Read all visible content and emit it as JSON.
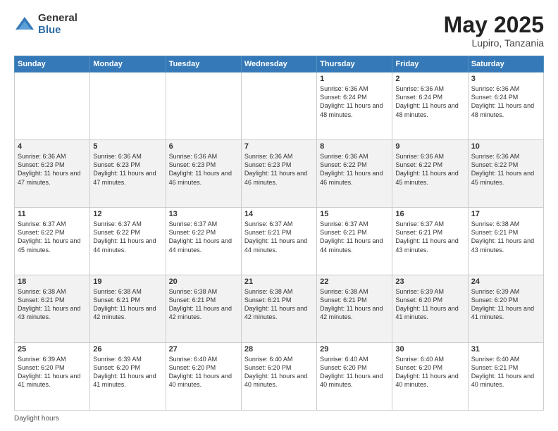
{
  "logo": {
    "general": "General",
    "blue": "Blue"
  },
  "title": {
    "month": "May 2025",
    "location": "Lupiro, Tanzania"
  },
  "days_of_week": [
    "Sunday",
    "Monday",
    "Tuesday",
    "Wednesday",
    "Thursday",
    "Friday",
    "Saturday"
  ],
  "footer": {
    "daylight_label": "Daylight hours"
  },
  "weeks": [
    [
      {
        "day": "",
        "info": ""
      },
      {
        "day": "",
        "info": ""
      },
      {
        "day": "",
        "info": ""
      },
      {
        "day": "",
        "info": ""
      },
      {
        "day": "1",
        "info": "Sunrise: 6:36 AM\nSunset: 6:24 PM\nDaylight: 11 hours\nand 48 minutes."
      },
      {
        "day": "2",
        "info": "Sunrise: 6:36 AM\nSunset: 6:24 PM\nDaylight: 11 hours\nand 48 minutes."
      },
      {
        "day": "3",
        "info": "Sunrise: 6:36 AM\nSunset: 6:24 PM\nDaylight: 11 hours\nand 48 minutes."
      }
    ],
    [
      {
        "day": "4",
        "info": "Sunrise: 6:36 AM\nSunset: 6:23 PM\nDaylight: 11 hours\nand 47 minutes."
      },
      {
        "day": "5",
        "info": "Sunrise: 6:36 AM\nSunset: 6:23 PM\nDaylight: 11 hours\nand 47 minutes."
      },
      {
        "day": "6",
        "info": "Sunrise: 6:36 AM\nSunset: 6:23 PM\nDaylight: 11 hours\nand 46 minutes."
      },
      {
        "day": "7",
        "info": "Sunrise: 6:36 AM\nSunset: 6:23 PM\nDaylight: 11 hours\nand 46 minutes."
      },
      {
        "day": "8",
        "info": "Sunrise: 6:36 AM\nSunset: 6:22 PM\nDaylight: 11 hours\nand 46 minutes."
      },
      {
        "day": "9",
        "info": "Sunrise: 6:36 AM\nSunset: 6:22 PM\nDaylight: 11 hours\nand 45 minutes."
      },
      {
        "day": "10",
        "info": "Sunrise: 6:36 AM\nSunset: 6:22 PM\nDaylight: 11 hours\nand 45 minutes."
      }
    ],
    [
      {
        "day": "11",
        "info": "Sunrise: 6:37 AM\nSunset: 6:22 PM\nDaylight: 11 hours\nand 45 minutes."
      },
      {
        "day": "12",
        "info": "Sunrise: 6:37 AM\nSunset: 6:22 PM\nDaylight: 11 hours\nand 44 minutes."
      },
      {
        "day": "13",
        "info": "Sunrise: 6:37 AM\nSunset: 6:22 PM\nDaylight: 11 hours\nand 44 minutes."
      },
      {
        "day": "14",
        "info": "Sunrise: 6:37 AM\nSunset: 6:21 PM\nDaylight: 11 hours\nand 44 minutes."
      },
      {
        "day": "15",
        "info": "Sunrise: 6:37 AM\nSunset: 6:21 PM\nDaylight: 11 hours\nand 44 minutes."
      },
      {
        "day": "16",
        "info": "Sunrise: 6:37 AM\nSunset: 6:21 PM\nDaylight: 11 hours\nand 43 minutes."
      },
      {
        "day": "17",
        "info": "Sunrise: 6:38 AM\nSunset: 6:21 PM\nDaylight: 11 hours\nand 43 minutes."
      }
    ],
    [
      {
        "day": "18",
        "info": "Sunrise: 6:38 AM\nSunset: 6:21 PM\nDaylight: 11 hours\nand 43 minutes."
      },
      {
        "day": "19",
        "info": "Sunrise: 6:38 AM\nSunset: 6:21 PM\nDaylight: 11 hours\nand 42 minutes."
      },
      {
        "day": "20",
        "info": "Sunrise: 6:38 AM\nSunset: 6:21 PM\nDaylight: 11 hours\nand 42 minutes."
      },
      {
        "day": "21",
        "info": "Sunrise: 6:38 AM\nSunset: 6:21 PM\nDaylight: 11 hours\nand 42 minutes."
      },
      {
        "day": "22",
        "info": "Sunrise: 6:38 AM\nSunset: 6:21 PM\nDaylight: 11 hours\nand 42 minutes."
      },
      {
        "day": "23",
        "info": "Sunrise: 6:39 AM\nSunset: 6:20 PM\nDaylight: 11 hours\nand 41 minutes."
      },
      {
        "day": "24",
        "info": "Sunrise: 6:39 AM\nSunset: 6:20 PM\nDaylight: 11 hours\nand 41 minutes."
      }
    ],
    [
      {
        "day": "25",
        "info": "Sunrise: 6:39 AM\nSunset: 6:20 PM\nDaylight: 11 hours\nand 41 minutes."
      },
      {
        "day": "26",
        "info": "Sunrise: 6:39 AM\nSunset: 6:20 PM\nDaylight: 11 hours\nand 41 minutes."
      },
      {
        "day": "27",
        "info": "Sunrise: 6:40 AM\nSunset: 6:20 PM\nDaylight: 11 hours\nand 40 minutes."
      },
      {
        "day": "28",
        "info": "Sunrise: 6:40 AM\nSunset: 6:20 PM\nDaylight: 11 hours\nand 40 minutes."
      },
      {
        "day": "29",
        "info": "Sunrise: 6:40 AM\nSunset: 6:20 PM\nDaylight: 11 hours\nand 40 minutes."
      },
      {
        "day": "30",
        "info": "Sunrise: 6:40 AM\nSunset: 6:20 PM\nDaylight: 11 hours\nand 40 minutes."
      },
      {
        "day": "31",
        "info": "Sunrise: 6:40 AM\nSunset: 6:21 PM\nDaylight: 11 hours\nand 40 minutes."
      }
    ]
  ]
}
